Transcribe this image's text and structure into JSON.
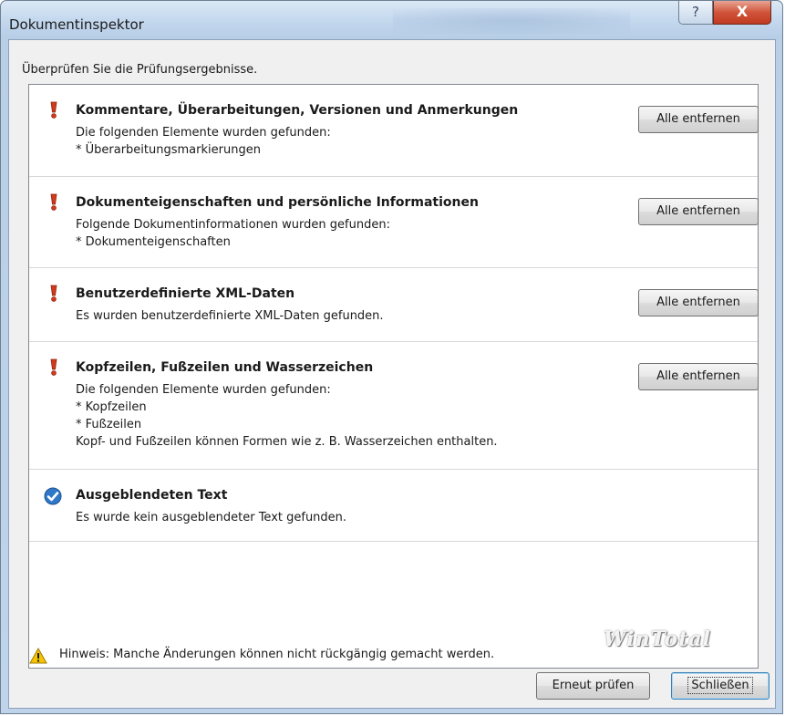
{
  "window": {
    "title": "Dokumentinspektor",
    "help_glyph": "?",
    "close_glyph": "X"
  },
  "intro": "Überprüfen Sie die Prüfungsergebnisse.",
  "sections": [
    {
      "status": "warning",
      "title": "Kommentare, Überarbeitungen, Versionen und Anmerkungen",
      "lines": [
        "Die folgenden Elemente wurden gefunden:",
        "* Überarbeitungsmarkierungen"
      ],
      "button": "Alle entfernen"
    },
    {
      "status": "warning",
      "title": "Dokumenteigenschaften und persönliche Informationen",
      "lines": [
        "Folgende Dokumentinformationen wurden gefunden:",
        "* Dokumenteigenschaften"
      ],
      "button": "Alle entfernen"
    },
    {
      "status": "warning",
      "title": "Benutzerdefinierte XML-Daten",
      "lines": [
        "Es wurden benutzerdefinierte XML-Daten gefunden."
      ],
      "button": "Alle entfernen"
    },
    {
      "status": "warning",
      "title": "Kopfzeilen, Fußzeilen und Wasserzeichen",
      "lines": [
        "Die folgenden Elemente wurden gefunden:",
        "* Kopfzeilen",
        "* Fußzeilen",
        "Kopf- und Fußzeilen können Formen wie z. B. Wasserzeichen enthalten."
      ],
      "button": "Alle entfernen"
    },
    {
      "status": "ok",
      "title": "Ausgeblendeten Text",
      "lines": [
        "Es wurde kein ausgeblendeter Text gefunden."
      ]
    }
  ],
  "footer": {
    "warning_icon": "warning-triangle-icon",
    "note": "Hinweis: Manche Änderungen können nicht rückgängig gemacht werden.",
    "watermark": "WinTotal",
    "recheck_label": "Erneut prüfen",
    "close_label": "Schließen"
  },
  "colors": {
    "warning_icon": "#d33a1c",
    "ok_icon": "#2f78c9",
    "close_button": "#c9432a"
  }
}
